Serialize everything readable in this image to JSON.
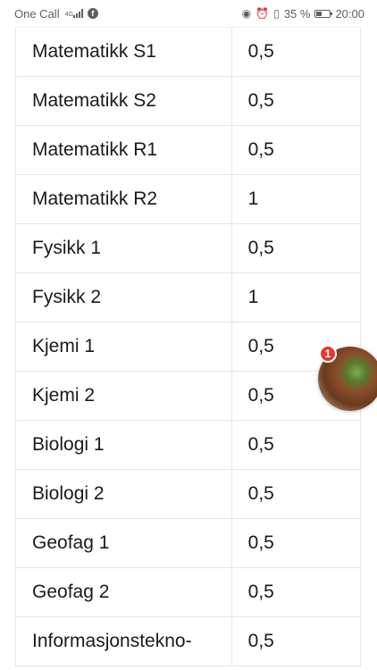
{
  "status_bar": {
    "carrier": "One Call",
    "network": "4G",
    "battery_percent": "35 %",
    "time": "20:00"
  },
  "table": {
    "rows": [
      {
        "subject": "Matematikk S1",
        "value": "0,5"
      },
      {
        "subject": "Matematikk S2",
        "value": "0,5"
      },
      {
        "subject": "Matematikk R1",
        "value": "0,5"
      },
      {
        "subject": "Matematikk R2",
        "value": "1"
      },
      {
        "subject": "Fysikk 1",
        "value": "0,5"
      },
      {
        "subject": "Fysikk 2",
        "value": "1"
      },
      {
        "subject": "Kjemi 1",
        "value": "0,5"
      },
      {
        "subject": "Kjemi 2",
        "value": "0,5"
      },
      {
        "subject": "Biologi 1",
        "value": "0,5"
      },
      {
        "subject": "Biologi 2",
        "value": "0,5"
      },
      {
        "subject": "Geofag 1",
        "value": "0,5"
      },
      {
        "subject": "Geofag 2",
        "value": "0,5"
      },
      {
        "subject": "Informasjonstekno-",
        "value": "0,5"
      }
    ]
  },
  "chat_head": {
    "badge_count": "1"
  }
}
